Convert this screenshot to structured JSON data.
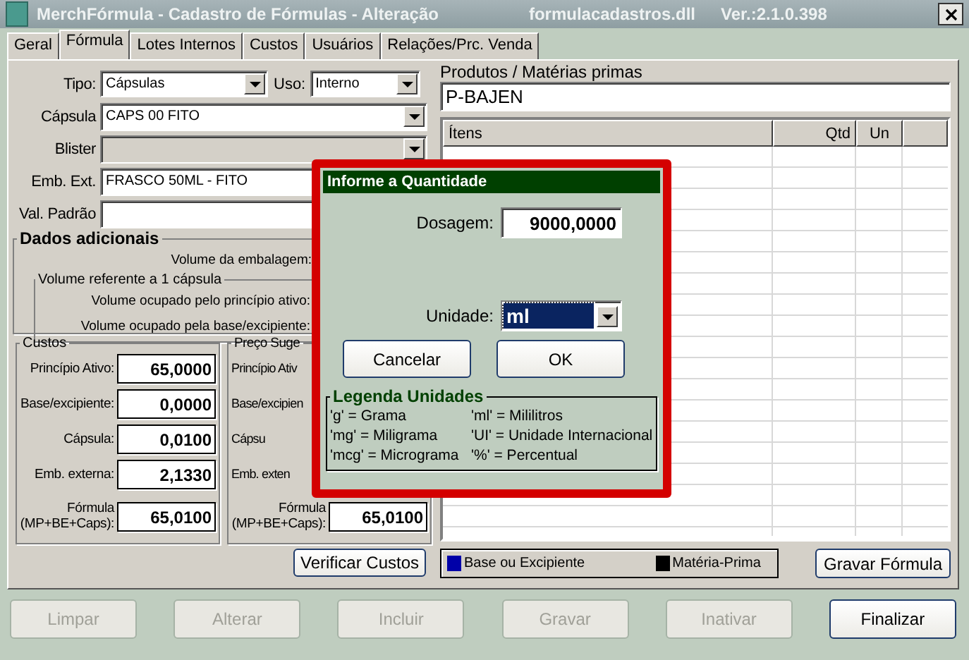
{
  "window": {
    "title": "MerchFórmula - Cadastro de Fórmulas - Alteração",
    "module": "formulacadastros.dll",
    "version": "Ver.:2.1.0.398"
  },
  "tabs": [
    {
      "label": "Geral",
      "selected": false
    },
    {
      "label": "Fórmula",
      "selected": true
    },
    {
      "label": "Lotes Internos",
      "selected": false
    },
    {
      "label": "Custos",
      "selected": false
    },
    {
      "label": "Usuários",
      "selected": false
    },
    {
      "label": "Relações/Prc. Venda",
      "selected": false
    }
  ],
  "form": {
    "tipo": {
      "label": "Tipo:",
      "value": "Cápsulas"
    },
    "uso": {
      "label": "Uso:",
      "value": "Interno"
    },
    "fields": [
      {
        "kind": "select",
        "label": "Cápsula",
        "value": "CAPS 00 FITO",
        "disabled": false
      },
      {
        "kind": "select",
        "label": "Blister",
        "disabled": true
      },
      {
        "kind": "text",
        "label": "Emb. Ext.",
        "value": "FRASCO 50ML - FITO",
        "disabled": false
      },
      {
        "kind": "text",
        "label": "Val. Padrão",
        "disabled": false
      }
    ]
  },
  "dados_adicionais": {
    "title": "Dados adicionais",
    "volume_embalagem": "Volume da embalagem:",
    "group_title": "Volume referente a 1 cápsula",
    "rows": [
      "Volume ocupado pelo princípio ativo:",
      "Volume ocupado pela base/excipiente:"
    ]
  },
  "custos": {
    "title": "Custos",
    "rows": [
      {
        "label": [
          "Princípio Ativo:"
        ],
        "value": "65,0000"
      },
      {
        "label": [
          "Base/excipiente:"
        ],
        "value": "0,0000"
      },
      {
        "label": [
          "Cápsula:"
        ],
        "value": "0,0100"
      },
      {
        "label": [
          "Emb. externa:"
        ],
        "value": "2,1330"
      },
      {
        "label": [
          "Fórmula",
          "(MP+BE+Caps):"
        ],
        "value": "65,0100"
      }
    ]
  },
  "preco": {
    "title": "Preço Suge",
    "rows": [
      {
        "label": [
          "Princípio Ativ"
        ]
      },
      {
        "label": [
          "Base/excipien"
        ]
      },
      {
        "label": [
          "Cápsu"
        ]
      },
      {
        "label": [
          "Emb. exten"
        ]
      },
      {
        "label": [
          "Fórmula",
          "(MP+BE+Caps):"
        ],
        "value": "65,0100"
      }
    ]
  },
  "verify_button": "Verificar Custos",
  "produtos": {
    "label": "Produtos / Matérias primas",
    "value": "P-BAJEN",
    "columns": [
      "Ítens",
      "Qtd",
      "Un"
    ],
    "legend": [
      {
        "label": "Base ou Excipiente",
        "color": "#0000a8"
      },
      {
        "label": "Matéria-Prima",
        "color": "#000000"
      }
    ],
    "save_button": "Gravar Fórmula"
  },
  "actions": [
    {
      "label": "Limpar",
      "disabled": true
    },
    {
      "label": "Alterar",
      "disabled": true
    },
    {
      "label": "Incluir",
      "disabled": true
    },
    {
      "label": "Gravar",
      "disabled": true
    },
    {
      "label": "Inativar",
      "disabled": true
    },
    {
      "label": "Finalizar",
      "disabled": false
    }
  ],
  "dialog": {
    "title": "Informe a Quantidade",
    "dosage": {
      "label": "Dosagem:",
      "value": "9000,0000"
    },
    "unit": {
      "label": "Unidade:",
      "value": "ml"
    },
    "buttons": [
      "Cancelar",
      "OK"
    ],
    "legend_title": "Legenda Unidades",
    "legend": [
      "'g' = Grama",
      "'ml' = Mililitros",
      "'mg' = Miligrama",
      "'UI' = Unidade Internacional",
      "'mcg' = Micrograma",
      "'%' = Percentual"
    ]
  }
}
